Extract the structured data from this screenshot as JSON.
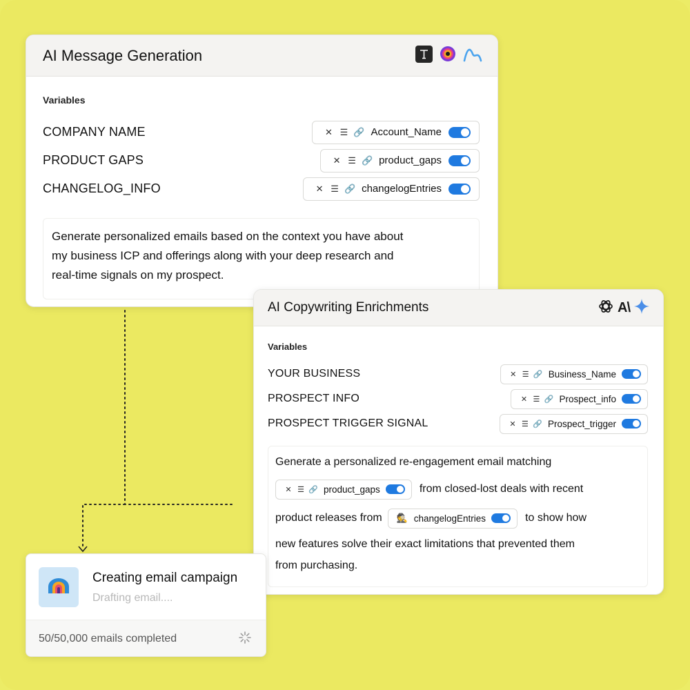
{
  "card1": {
    "title": "AI Message Generation",
    "logos": [
      "typeform-t-icon",
      "circle-logo-icon",
      "wave-logo-icon"
    ],
    "variables_label": "Variables",
    "variables": [
      {
        "name": "COMPANY NAME",
        "chip": "Account_Name",
        "enabled": true
      },
      {
        "name": "PRODUCT GAPS",
        "chip": "product_gaps",
        "enabled": true
      },
      {
        "name": "CHANGELOG_INFO",
        "chip": "changelogEntries",
        "enabled": true
      }
    ],
    "prompt_lines": [
      "Generate personalized emails based on the context you have about",
      "my business ICP and offerings along with your deep research and",
      "real-time signals on my prospect."
    ]
  },
  "card2": {
    "title": "AI Copywriting Enrichments",
    "logos": [
      "openai-logo-icon",
      "anthropic-logo-icon",
      "gemini-sparkle-icon"
    ],
    "variables_label": "Variables",
    "variables": [
      {
        "name": "YOUR BUSINESS",
        "chip": "Business_Name",
        "enabled": true
      },
      {
        "name": "PROSPECT INFO",
        "chip": "Prospect_info",
        "enabled": true
      },
      {
        "name": "PROSPECT TRIGGER SIGNAL",
        "chip": "Prospect_trigger",
        "enabled": true
      }
    ],
    "prompt": {
      "line1": "Generate a personalized re-engagement email matching",
      "chip1": "product_gaps",
      "line2_after": "from closed-lost deals with recent",
      "line3_before": "product releases from",
      "chip2": "changelogEntries",
      "line3_after": "to show how",
      "line4": "new features solve their exact limitations that prevented them",
      "line5": "from purchasing."
    }
  },
  "card3": {
    "title": "Creating email campaign",
    "subtitle": "Drafting email....",
    "progress": "50/50,000 emails completed"
  },
  "colors": {
    "background": "#ebe961",
    "toggle_on": "#1f7ae0",
    "card": "#ffffff",
    "header": "#f4f3f1"
  }
}
